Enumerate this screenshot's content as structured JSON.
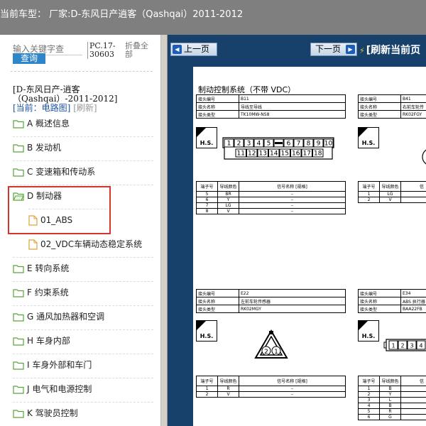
{
  "header": {
    "title": "当前车型：  厂家:D-东风日产逍客（Qashqai）2011-2012"
  },
  "sidebar": {
    "search_placeholder": "输入关键字查",
    "search_button": "查询",
    "version": "PC.17-30603",
    "collapse_all": "折叠全部",
    "model_line": "[D-东风日产-逍客（Qashqai）-2011-2012]",
    "current_prefix": "[当前：电路图]",
    "refresh": "[刷新]",
    "items": [
      {
        "label": "A 概述信息"
      },
      {
        "label": "B 发动机"
      },
      {
        "label": "C 变速箱和传动系"
      },
      {
        "label": "D 制动器"
      },
      {
        "label": "01_ABS"
      },
      {
        "label": "02_VDC车辆动态稳定系统"
      },
      {
        "label": "E 转向系统"
      },
      {
        "label": "F 约束系统"
      },
      {
        "label": "G 通风加热器和空调"
      },
      {
        "label": "H 车身内部"
      },
      {
        "label": "I 车身外部和车门"
      },
      {
        "label": "J 电气和电源控制"
      },
      {
        "label": "K 驾驶员控制"
      }
    ]
  },
  "toolbar": {
    "prev_label": "上一页",
    "next_label": "下一页",
    "refresh_label": "[刷新当前页"
  },
  "document": {
    "title": "制动控制系统（不带 VDC）",
    "hs_label": "H.S.",
    "block1": {
      "rows": [
        [
          "接头编号",
          "B11"
        ],
        [
          "接头名称",
          "导线至导线"
        ],
        [
          "接头类型",
          "TK10MW-NS8"
        ]
      ],
      "pins_top": [
        "1",
        "2",
        "3",
        "4",
        "5",
        "",
        "6",
        "7",
        "8",
        "9",
        "10"
      ],
      "pins_bottom": [
        "11",
        "12",
        "13",
        "14",
        "15",
        "16",
        "17",
        "18"
      ],
      "table_header": [
        "端子号",
        "导线颜色",
        "信号名称 [规格]"
      ],
      "table_rows": [
        [
          "5",
          "BR",
          "–"
        ],
        [
          "6",
          "Y",
          "–"
        ],
        [
          "7",
          "LG",
          "–"
        ],
        [
          "8",
          "V",
          "–"
        ]
      ]
    },
    "block2": {
      "rows": [
        [
          "接头编号",
          "B41"
        ],
        [
          "接头名称",
          "右前车轮传"
        ],
        [
          "接头类型",
          "RK02FGY"
        ]
      ],
      "table_header": [
        "端子号",
        "导线颜色",
        "信"
      ],
      "table_rows": [
        [
          "1",
          "LG",
          ""
        ],
        [
          "2",
          "V",
          ""
        ]
      ]
    },
    "block3": {
      "rows": [
        [
          "接头编号",
          "E22"
        ],
        [
          "接头名称",
          "左前车轮传感器"
        ],
        [
          "接头类型",
          "RK02MGY"
        ]
      ],
      "pins": [
        "2",
        "1"
      ],
      "table_header": [
        "端子号",
        "导线颜色",
        "信号名称 [规格]"
      ],
      "table_rows": [
        [
          "1",
          "R",
          "–"
        ],
        [
          "2",
          "V",
          "–"
        ]
      ]
    },
    "block4": {
      "rows": [
        [
          "接头编号",
          "E34"
        ],
        [
          "接头名称",
          "ABS 执行器"
        ],
        [
          "接头类型",
          "BAA22FB"
        ]
      ],
      "pins": [
        "1",
        "2",
        "3",
        "4"
      ],
      "table_header": [
        "端子号",
        "导线颜色",
        "信"
      ],
      "table_rows": [
        [
          "1",
          "B",
          ""
        ],
        [
          "2",
          "Y",
          ""
        ],
        [
          "3",
          "L",
          ""
        ],
        [
          "4",
          "B",
          ""
        ],
        [
          "5",
          "R",
          ""
        ],
        [
          "6",
          "G",
          ""
        ]
      ]
    }
  },
  "colors": {
    "header_bg": "#7f7f7f",
    "viewer_bg": "#17416b",
    "accent": "#2e86c9",
    "highlight": "#d9342b"
  }
}
